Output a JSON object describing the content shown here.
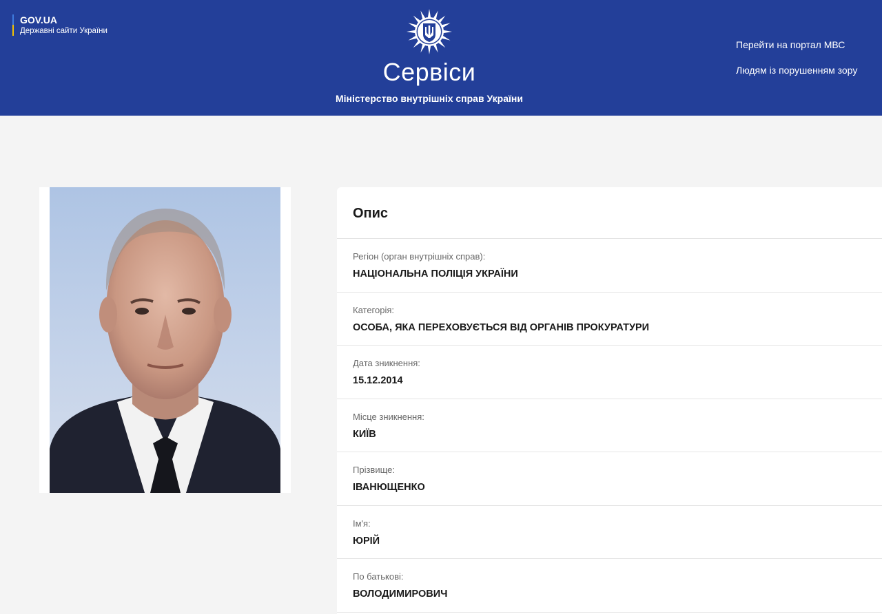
{
  "header": {
    "gov_title": "GOV.UA",
    "gov_subtitle": "Державні сайти України",
    "site_title": "Сервіси",
    "site_subtitle": "Міністерство внутрішніх справ України",
    "links": {
      "portal": "Перейти на портал МВС",
      "accessibility": "Людям із порушенням зору"
    }
  },
  "card": {
    "title": "Опис",
    "rows": [
      {
        "label": "Регіон (орган внутрішніх справ):",
        "value": "НАЦІОНАЛЬНА ПОЛІЦІЯ УКРАЇНИ"
      },
      {
        "label": "Категорія:",
        "value": "ОСОБА, ЯКА ПЕРЕХОВУЄТЬСЯ ВІД ОРГАНІВ ПРОКУРАТУРИ"
      },
      {
        "label": "Дата зникнення:",
        "value": "15.12.2014"
      },
      {
        "label": "Місце зникнення:",
        "value": "КИЇВ"
      },
      {
        "label": "Прізвище:",
        "value": "ІВАНЮЩЕНКО"
      },
      {
        "label": "Ім'я:",
        "value": "ЮРІЙ"
      },
      {
        "label": "По батькові:",
        "value": "ВОЛОДИМИРОВИЧ"
      }
    ]
  },
  "colors": {
    "header_bg": "#233f99",
    "page_bg": "#f4f4f4",
    "accent_yellow": "#f5c400"
  },
  "icons": {
    "emblem": "mvs-star-trident-emblem",
    "photo": "person-portrait"
  }
}
